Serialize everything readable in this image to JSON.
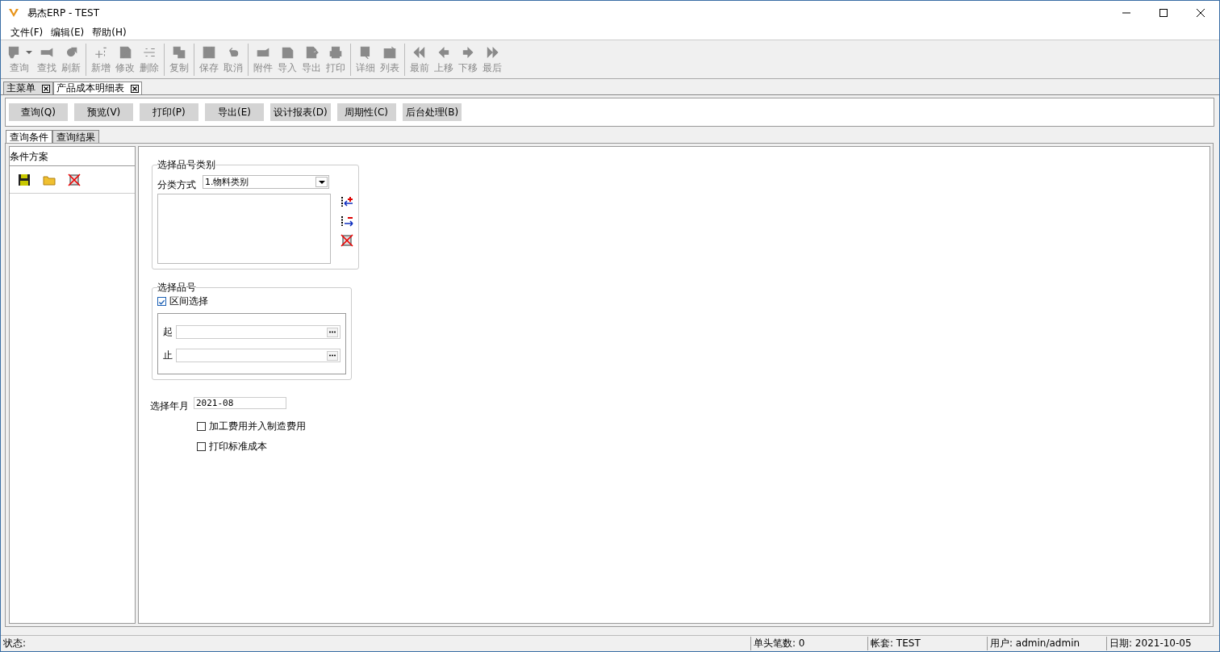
{
  "window": {
    "title": "易杰ERP - TEST"
  },
  "menu": [
    "文件(F)",
    "编辑(E)",
    "帮助(H)"
  ],
  "toolbar": {
    "groups": [
      [
        {
          "label": "查询",
          "disabled": true
        },
        {
          "label": "查找",
          "disabled": true
        },
        {
          "label": "刷新",
          "disabled": true
        }
      ],
      [
        {
          "label": "新增",
          "disabled": true
        },
        {
          "label": "修改",
          "disabled": true
        },
        {
          "label": "删除",
          "disabled": true
        }
      ],
      [
        {
          "label": "复制",
          "disabled": true
        }
      ],
      [
        {
          "label": "保存",
          "disabled": true
        },
        {
          "label": "取消",
          "disabled": true
        }
      ],
      [
        {
          "label": "附件",
          "disabled": true
        },
        {
          "label": "导入",
          "disabled": true
        },
        {
          "label": "导出",
          "disabled": true
        },
        {
          "label": "打印",
          "disabled": true
        }
      ],
      [
        {
          "label": "详细",
          "disabled": true
        },
        {
          "label": "列表",
          "disabled": true
        }
      ],
      [
        {
          "label": "最前",
          "disabled": true
        },
        {
          "label": "上移",
          "disabled": true
        },
        {
          "label": "下移",
          "disabled": true
        },
        {
          "label": "最后",
          "disabled": true
        }
      ]
    ]
  },
  "document_tabs": [
    {
      "label": "主菜单",
      "selected": false
    },
    {
      "label": "产品成本明细表",
      "selected": true
    }
  ],
  "action_buttons": [
    "查询(Q)",
    "预览(V)",
    "打印(P)",
    "导出(E)",
    "设计报表(D)",
    "周期性(C)",
    "后台处理(B)"
  ],
  "sub_tabs": [
    {
      "label": "查询条件",
      "selected": true
    },
    {
      "label": "查询结果",
      "selected": false
    }
  ],
  "scheme_panel": {
    "title": "条件方案"
  },
  "category_group": {
    "title": "选择品号类别",
    "classify_label": "分类方式",
    "classify_value": "1.物料类别"
  },
  "item_group": {
    "title": "选择品号",
    "range_select": {
      "label": "区间选择",
      "checked": true
    },
    "from_label": "起",
    "to_label": "止"
  },
  "period": {
    "label": "选择年月",
    "value": "2021-08"
  },
  "options": [
    {
      "label": "加工费用并入制造费用",
      "checked": false
    },
    {
      "label": "打印标准成本",
      "checked": false
    }
  ],
  "status_bar": {
    "status": "状态:",
    "header_count": "单头笔数: 0",
    "account": "帐套: TEST",
    "user": "用户: admin/admin",
    "date": "日期: 2021-10-05"
  }
}
